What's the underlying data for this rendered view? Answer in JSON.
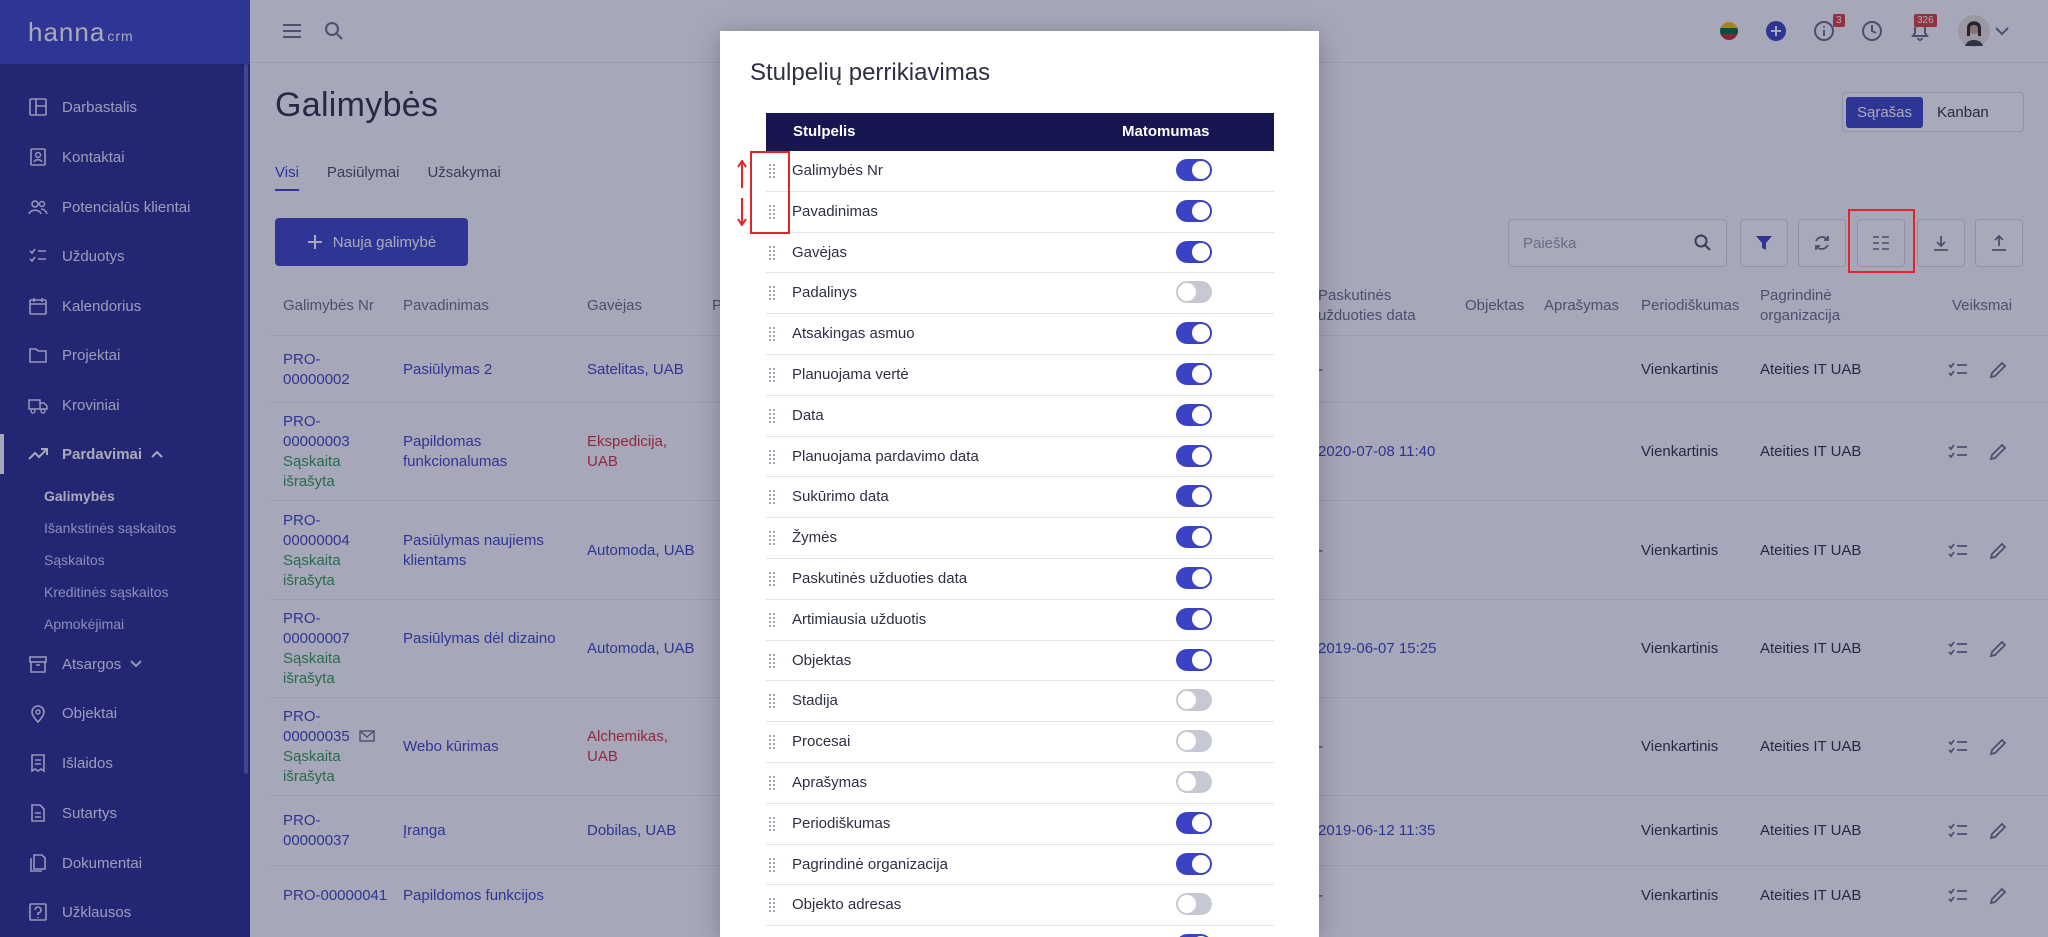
{
  "app": {
    "logo": "hanna",
    "logo_suffix": "crm",
    "accent": "#3b43c4",
    "sidebar_bg": "#262b8e"
  },
  "nav": {
    "items": [
      {
        "label": "Darbastalis",
        "icon": "dashboard-icon"
      },
      {
        "label": "Kontaktai",
        "icon": "contacts-icon"
      },
      {
        "label": "Potencialūs klientai",
        "icon": "people-icon"
      },
      {
        "label": "Užduotys",
        "icon": "tasks-icon"
      },
      {
        "label": "Kalendorius",
        "icon": "calendar-icon"
      },
      {
        "label": "Projektai",
        "icon": "folder-icon"
      },
      {
        "label": "Kroviniai",
        "icon": "truck-icon"
      },
      {
        "label": "Pardavimai",
        "icon": "trend-icon",
        "active": true
      },
      {
        "label": "Atsargos",
        "icon": "box-icon"
      },
      {
        "label": "Objektai",
        "icon": "pin-icon"
      },
      {
        "label": "Išlaidos",
        "icon": "receipt-icon"
      },
      {
        "label": "Sutartys",
        "icon": "document-icon"
      },
      {
        "label": "Dokumentai",
        "icon": "documents-icon"
      },
      {
        "label": "Užklausos",
        "icon": "question-icon"
      }
    ],
    "sub": [
      "Galimybės",
      "Išankstinės sąskaitos",
      "Sąskaitos",
      "Kreditinės sąskaitos",
      "Apmokėjimai"
    ]
  },
  "topbar": {
    "info_badge": "3",
    "notif_badge": "326"
  },
  "page": {
    "title": "Galimybės",
    "tabs": [
      "Visi",
      "Pasiūlymai",
      "Užsakymai"
    ],
    "new_button": "Nauja galimybė",
    "view": [
      "Sąrašas",
      "Kanban"
    ],
    "search_placeholder": "Paieška"
  },
  "table": {
    "headers": [
      "Galimybės Nr",
      "Pavadinimas",
      "Gavėjas",
      "P",
      "Paskutinės užduoties data",
      "Objektas",
      "Aprašymas",
      "Periodiškumas",
      "Pagrindinė organizacija",
      "Veiksmai"
    ],
    "rows": [
      {
        "nr": "PRO-00000002",
        "name": "Pasiūlymas 2",
        "recv": "Satelitas, UAB",
        "status": "",
        "date": "-",
        "period": "Vienkartinis",
        "org": "Ateities IT UAB"
      },
      {
        "nr": "PRO-00000003",
        "name": "Papildomas funkcionalumas",
        "recv": "Ekspedicija, UAB",
        "status": "Sąskaita išrašyta",
        "date": "2020-07-08 11:40",
        "period": "Vienkartinis",
        "org": "Ateities IT UAB"
      },
      {
        "nr": "PRO-00000004",
        "name": "Pasiūlymas naujiems klientams",
        "recv": "Automoda, UAB",
        "status": "Sąskaita išrašyta",
        "date": "-",
        "period": "Vienkartinis",
        "org": "Ateities IT UAB"
      },
      {
        "nr": "PRO-00000007",
        "name": "Pasiūlymas dėl dizaino",
        "recv": "Automoda, UAB",
        "status": "Sąskaita išrašyta",
        "date": "2019-06-07 15:25",
        "period": "Vienkartinis",
        "org": "Ateities IT UAB"
      },
      {
        "nr": "PRO-00000035",
        "name": "Webo kūrimas",
        "recv": "Alchemikas, UAB",
        "status": "Sąskaita išrašyta",
        "date": "-",
        "period": "Vienkartinis",
        "org": "Ateities IT UAB"
      },
      {
        "nr": "PRO-00000037",
        "name": "Įranga",
        "recv": "Dobilas, UAB",
        "status": "",
        "date": "2019-06-12 11:35",
        "period": "Vienkartinis",
        "org": "Ateities IT UAB"
      },
      {
        "nr": "PRO-00000041",
        "name": "Papildomos funkcijos",
        "recv": "",
        "status": "",
        "date": "-",
        "period": "Vienkartinis",
        "org": "Ateities IT UAB"
      }
    ]
  },
  "modal": {
    "title": "Stulpelių perrikiavimas",
    "col_header": "Stulpelis",
    "vis_header": "Matomumas",
    "columns": [
      {
        "label": "Galimybės Nr",
        "visible": true
      },
      {
        "label": "Pavadinimas",
        "visible": true
      },
      {
        "label": "Gavėjas",
        "visible": true
      },
      {
        "label": "Padalinys",
        "visible": false
      },
      {
        "label": "Atsakingas asmuo",
        "visible": true
      },
      {
        "label": "Planuojama vertė",
        "visible": true
      },
      {
        "label": "Data",
        "visible": true
      },
      {
        "label": "Planuojama pardavimo data",
        "visible": true
      },
      {
        "label": "Sukūrimo data",
        "visible": true
      },
      {
        "label": "Žymės",
        "visible": true
      },
      {
        "label": "Paskutinės užduoties data",
        "visible": true
      },
      {
        "label": "Artimiausia užduotis",
        "visible": true
      },
      {
        "label": "Objektas",
        "visible": true
      },
      {
        "label": "Stadija",
        "visible": false
      },
      {
        "label": "Procesai",
        "visible": false
      },
      {
        "label": "Aprašymas",
        "visible": false
      },
      {
        "label": "Periodiškumas",
        "visible": true
      },
      {
        "label": "Pagrindinė organizacija",
        "visible": true
      },
      {
        "label": "Objekto adresas",
        "visible": false
      },
      {
        "label": "",
        "visible": true
      }
    ]
  }
}
